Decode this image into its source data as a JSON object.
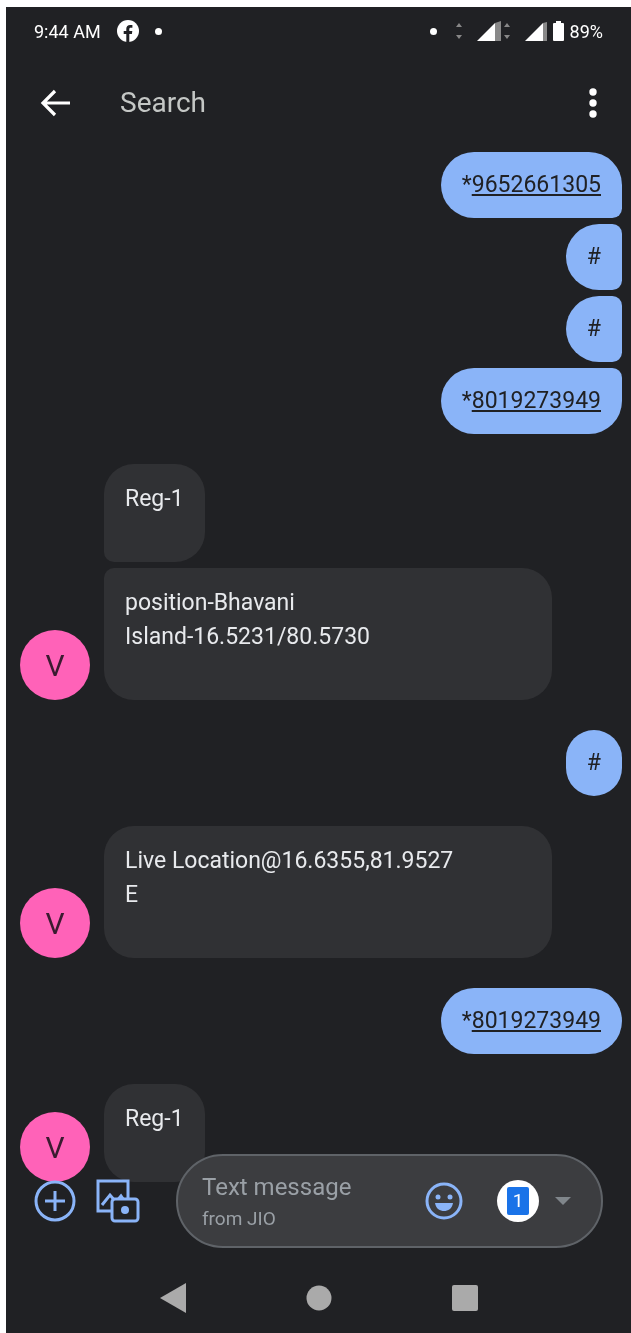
{
  "status_bar": {
    "time": "9:44 AM",
    "battery": "89%"
  },
  "header": {
    "search": {
      "placeholder": "Search"
    }
  },
  "messages": [
    {
      "kind": "outgoing",
      "prefix": "*",
      "link": "9652661305"
    },
    {
      "kind": "outgoing",
      "prefix": "#"
    },
    {
      "kind": "outgoing",
      "prefix": "#"
    },
    {
      "kind": "outgoing",
      "prefix": "*",
      "link": "8019273949"
    },
    {
      "kind": "incoming",
      "lines": [
        "Reg-1"
      ]
    },
    {
      "kind": "incoming",
      "lines": [
        "position-Bhavani",
        "Island-16.5231/80.5730"
      ],
      "avatar": "V"
    },
    {
      "kind": "outgoing",
      "prefix": "#"
    },
    {
      "kind": "incoming",
      "lines": [
        "Live Location@16.6355,81.9527",
        "E"
      ],
      "avatar": "V"
    },
    {
      "kind": "outgoing",
      "prefix": "*",
      "link": "8019273949"
    },
    {
      "kind": "incoming",
      "lines": [
        "Reg-1"
      ],
      "avatar": "V"
    }
  ],
  "compose": {
    "placeholder": "Text message",
    "sublabel": "from JIO",
    "sim": "1"
  }
}
